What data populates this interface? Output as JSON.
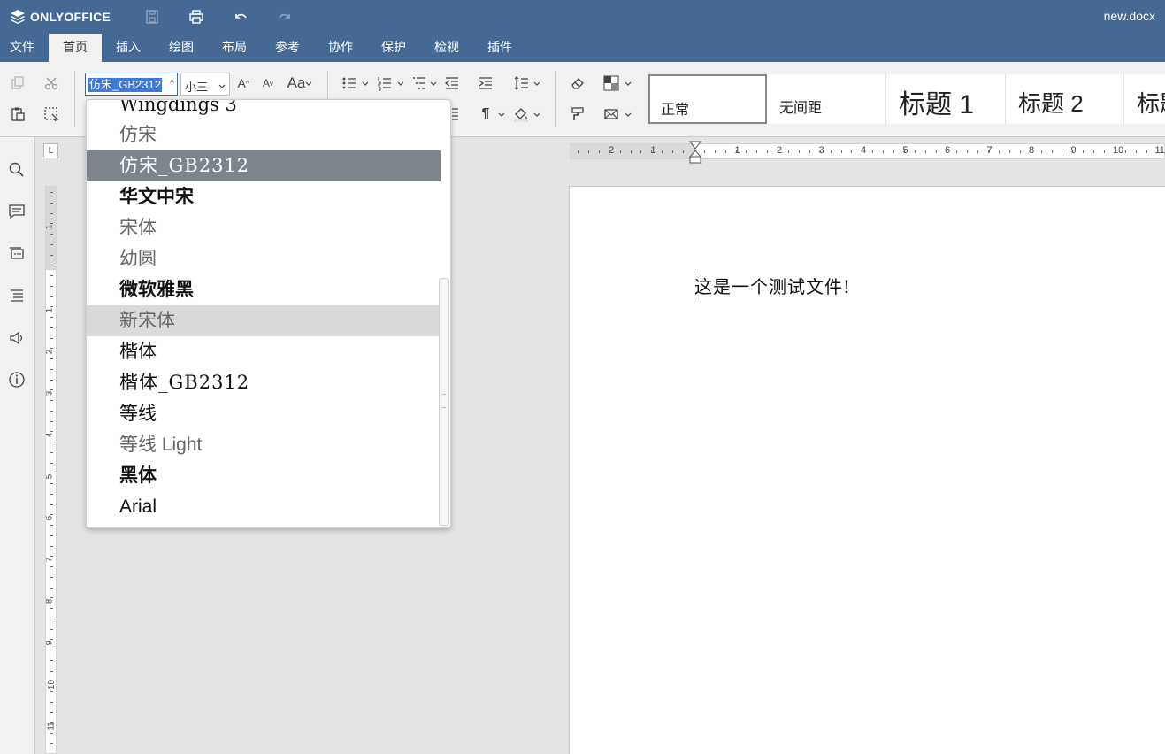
{
  "app": {
    "name": "ONLYOFFICE",
    "document_name": "new.docx"
  },
  "colors": {
    "header": "#446995",
    "toolbar": "#f1f1f1",
    "selection": "#3e7ad7",
    "dropdown_selected": "#7d858c"
  },
  "menu": {
    "tabs": [
      {
        "label": "文件",
        "active": false
      },
      {
        "label": "首页",
        "active": true
      },
      {
        "label": "插入",
        "active": false
      },
      {
        "label": "绘图",
        "active": false
      },
      {
        "label": "布局",
        "active": false
      },
      {
        "label": "参考",
        "active": false
      },
      {
        "label": "协作",
        "active": false
      },
      {
        "label": "保护",
        "active": false
      },
      {
        "label": "检视",
        "active": false
      },
      {
        "label": "插件",
        "active": false
      }
    ]
  },
  "toolbar": {
    "font_name": "仿宋_GB2312",
    "font_size": "小三",
    "increase_font_glyph": "A",
    "decrease_font_glyph": "A",
    "change_case_glyph": "Aa",
    "styles": [
      {
        "label": "正常",
        "selected": true
      },
      {
        "label": "无间距",
        "selected": false
      },
      {
        "label": "标题 1",
        "selected": false
      },
      {
        "label": "标题 2",
        "selected": false
      },
      {
        "label": "标题",
        "selected": false
      }
    ]
  },
  "ruler": {
    "horizontal_ticks": [
      "2",
      "1",
      "1",
      "2",
      "3",
      "4",
      "5",
      "6",
      "7",
      "8",
      "9",
      "10",
      "11"
    ],
    "vertical_ticks": [
      "1",
      "1",
      "2",
      "3",
      "4",
      "5",
      "6",
      "7",
      "8",
      "9",
      "10",
      "11"
    ],
    "tab_marker": "L"
  },
  "font_dropdown": {
    "items": [
      {
        "label": "Wingdings 3",
        "state": "normal"
      },
      {
        "label": "仿宋",
        "state": "normal"
      },
      {
        "label": "仿宋_GB2312",
        "state": "selected"
      },
      {
        "label": "华文中宋",
        "state": "normal"
      },
      {
        "label": "宋体",
        "state": "normal"
      },
      {
        "label": "幼圆",
        "state": "normal"
      },
      {
        "label": "微软雅黑",
        "state": "normal"
      },
      {
        "label": "新宋体",
        "state": "hover"
      },
      {
        "label": "楷体",
        "state": "normal"
      },
      {
        "label": "楷体_GB2312",
        "state": "normal"
      },
      {
        "label": "等线",
        "state": "normal"
      },
      {
        "label": "等线 Light",
        "state": "normal"
      },
      {
        "label": "黑体",
        "state": "normal"
      },
      {
        "label": "Arial",
        "state": "normal"
      }
    ]
  },
  "document": {
    "text": "这是一个测试文件!"
  }
}
